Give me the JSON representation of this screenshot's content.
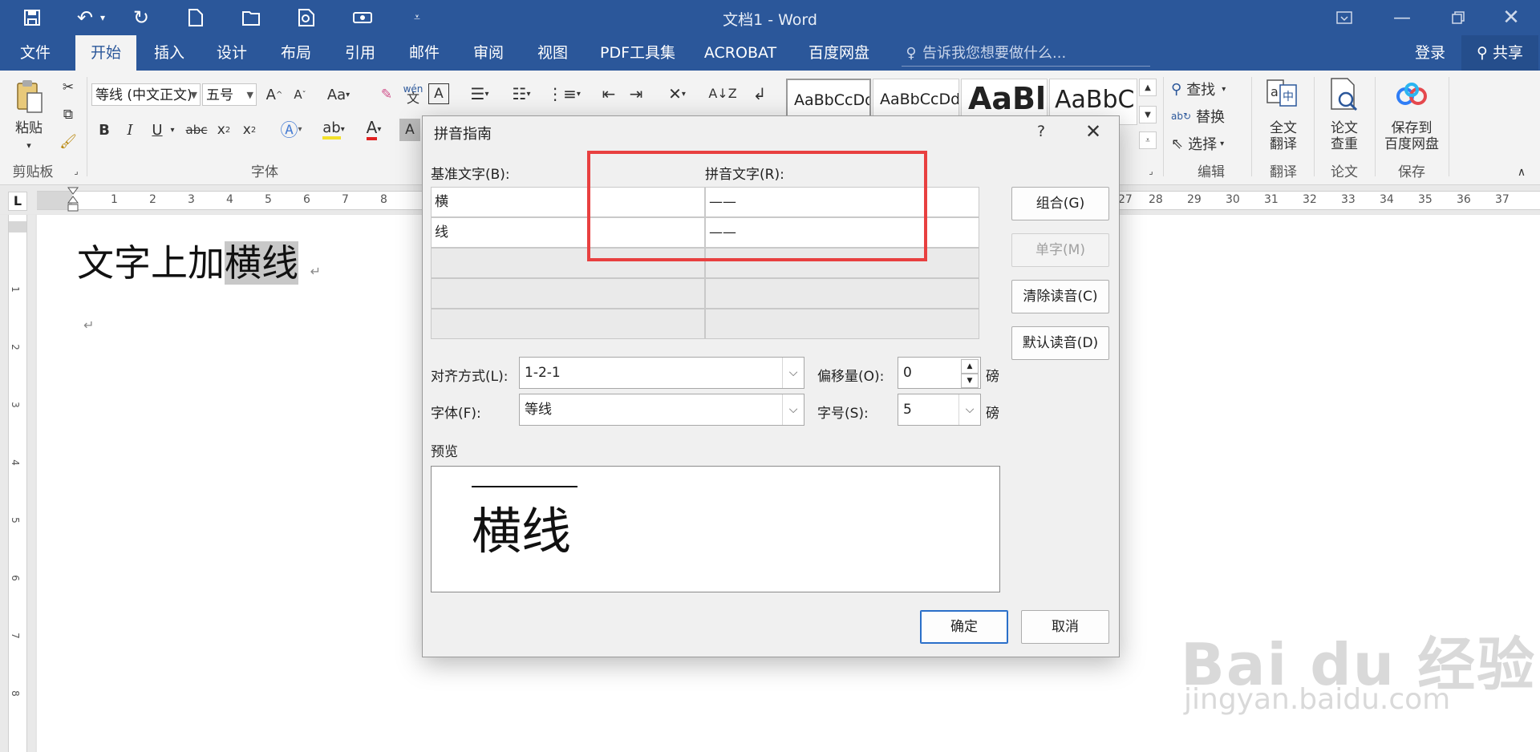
{
  "window": {
    "title": "文档1 - Word",
    "controls": [
      "ribbon-display",
      "minimize",
      "restore",
      "close"
    ]
  },
  "quick_access": [
    "save-icon",
    "undo-icon",
    "redo-icon",
    "new-doc-icon",
    "open-icon",
    "print-preview-icon",
    "touch-mode-icon",
    "customize-icon"
  ],
  "tabs": [
    "文件",
    "开始",
    "插入",
    "设计",
    "布局",
    "引用",
    "邮件",
    "审阅",
    "视图",
    "PDF工具集",
    "ACROBAT",
    "百度网盘"
  ],
  "active_tab": "开始",
  "tell_me": "告诉我您想要做什么...",
  "account": {
    "login": "登录",
    "share": "共享"
  },
  "ribbon": {
    "clipboard": {
      "paste": "粘贴",
      "label": "剪贴板"
    },
    "font": {
      "font_name": "等线 (中文正文)",
      "font_size": "五号",
      "change_case": "Aa",
      "label": "字体"
    },
    "styles": [
      "AaBbCcDd",
      "AaBbCcDd",
      "AaBl",
      "AaBbC"
    ],
    "editing": {
      "find": "查找",
      "replace": "替换",
      "select": "选择",
      "label": "编辑"
    },
    "translate": {
      "full": "全文\n翻译",
      "label": "翻译"
    },
    "paper": {
      "check": "论文\n查重",
      "label": "论文"
    },
    "save_baidu": {
      "btn": "保存到\n百度网盘",
      "label": "保存"
    }
  },
  "ruler": {
    "h_numbers": [
      "1",
      "2",
      "3",
      "4",
      "5",
      "6",
      "7",
      "8",
      "27",
      "28",
      "29",
      "30",
      "31",
      "32",
      "33",
      "34",
      "35",
      "36",
      "37"
    ],
    "v_numbers": [
      "1",
      "2",
      "3",
      "4",
      "5",
      "6",
      "7",
      "8"
    ],
    "corner": "L"
  },
  "document": {
    "prefix": "文字上加",
    "selected": "横线",
    "para_mark": "↵"
  },
  "dialog": {
    "title": "拼音指南",
    "help": "?",
    "base_label": "基准文字(B):",
    "ruby_label": "拼音文字(R):",
    "rows": [
      {
        "base": "横",
        "ruby": "——"
      },
      {
        "base": "线",
        "ruby": "——"
      },
      {
        "base": "",
        "ruby": ""
      },
      {
        "base": "",
        "ruby": ""
      },
      {
        "base": "",
        "ruby": ""
      }
    ],
    "buttons": {
      "group": "组合(G)",
      "mono": "单字(M)",
      "clear": "清除读音(C)",
      "default": "默认读音(D)"
    },
    "alignment": {
      "label": "对齐方式(L):",
      "value": "1-2-1"
    },
    "offset": {
      "label": "偏移量(O):",
      "value": "0",
      "unit": "磅"
    },
    "font": {
      "label": "字体(F):",
      "value": "等线"
    },
    "size": {
      "label": "字号(S):",
      "value": "5",
      "unit": "磅"
    },
    "preview_label": "预览",
    "preview_text": "横线",
    "ok": "确定",
    "cancel": "取消"
  },
  "watermark": {
    "brand": "Bai du 经验",
    "url": "jingyan.baidu.com"
  },
  "highlight_color": "#e84040",
  "accent_color": "#2b579a"
}
